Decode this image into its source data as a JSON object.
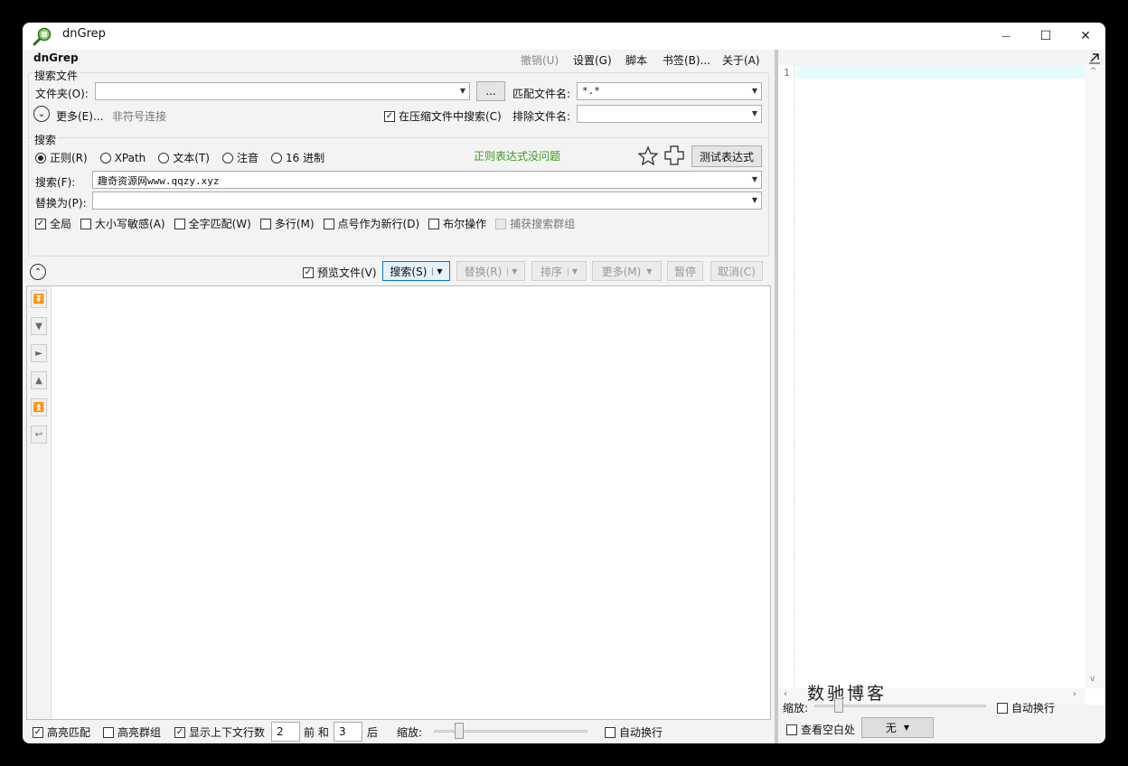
{
  "window": {
    "title": "dnGrep",
    "minimize_glyph": "—",
    "maximize_glyph": "☐",
    "close_glyph": "✕"
  },
  "menu": {
    "app_name": "dnGrep",
    "undo": "撤销(U)",
    "settings": "设置(G)",
    "script": "脚本",
    "bookmarks": "书签(B)...",
    "about": "关于(A)"
  },
  "search_files": {
    "group_label": "搜索文件",
    "folder_label": "文件夹(O):",
    "folder_value": "",
    "browse_label": "...",
    "pattern_label": "匹配文件名:",
    "pattern_value": "*.*",
    "more_label": "更多(E)...",
    "symlink_label": "非符号连接",
    "search_archives_label": "在压缩文件中搜索(C)",
    "exclude_label": "排除文件名:",
    "exclude_value": ""
  },
  "search": {
    "group_label": "搜索",
    "types": [
      "正则(R)",
      "XPath",
      "文本(T)",
      "注音",
      "16 进制"
    ],
    "selected_type": 0,
    "regex_status": "正则表达式没问题",
    "test_regex_label": "测试表达式",
    "search_label": "搜索(F):",
    "search_value": "趣奇资源网www.qqzy.xyz",
    "replace_label": "替换为(P):",
    "replace_value": "",
    "options": [
      {
        "label": "全局",
        "checked": true
      },
      {
        "label": "大小写敏感(A)",
        "checked": false
      },
      {
        "label": "全字匹配(W)",
        "checked": false
      },
      {
        "label": "多行(M)",
        "checked": false
      },
      {
        "label": "点号作为新行(D)",
        "checked": false
      },
      {
        "label": "布尔操作",
        "checked": false
      },
      {
        "label": "捕获搜索群组",
        "checked": false,
        "disabled": true
      }
    ]
  },
  "actions": {
    "preview_label": "预览文件(V)",
    "search_btn": "搜索(S)",
    "replace_btn": "替换(R)",
    "sort_btn": "排序",
    "more_btn": "更多(M)",
    "pause_btn": "暂停",
    "cancel_btn": "取消(C)"
  },
  "bottom": {
    "highlight_matches": "高亮匹配",
    "highlight_groups": "高亮群组",
    "show_context": "显示上下文行数",
    "before_value": "2",
    "before_label": "前 和",
    "after_value": "3",
    "after_label": "后",
    "zoom_label": "缩放:",
    "word_wrap": "自动换行"
  },
  "preview": {
    "line_number": "1",
    "watermark": "数驰博客",
    "zoom_label": "缩放:",
    "word_wrap": "自动换行",
    "show_whitespace": "查看空白处",
    "syntax_value": "无"
  },
  "colors": {
    "accent": "#0078d4",
    "status_ok": "#3c9b1d",
    "current_line": "#e6fbfb"
  }
}
